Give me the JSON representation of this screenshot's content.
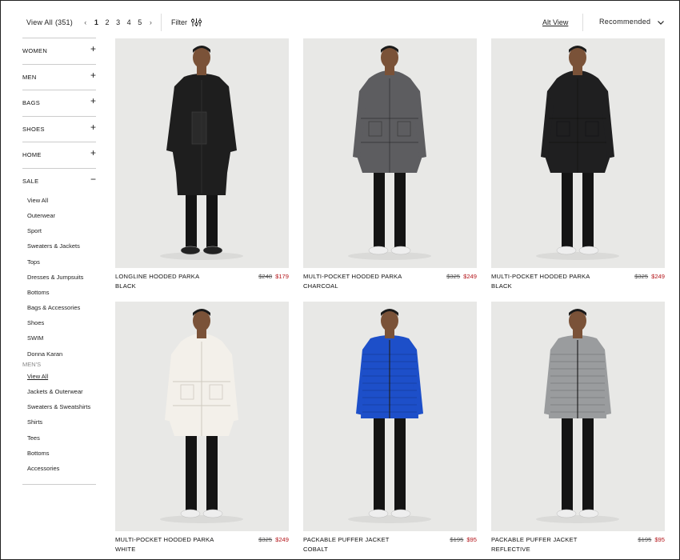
{
  "toolbar": {
    "view_all": "View All",
    "count": "(351)",
    "pages": [
      "1",
      "2",
      "3",
      "4",
      "5"
    ],
    "prev": "‹",
    "next": "›",
    "filter": "Filter",
    "alt_view": "Alt View",
    "sort": "Recommended"
  },
  "sidebar": {
    "categories": [
      {
        "label": "WOMEN",
        "toggle": "+"
      },
      {
        "label": "MEN",
        "toggle": "+"
      },
      {
        "label": "BAGS",
        "toggle": "+"
      },
      {
        "label": "SHOES",
        "toggle": "+"
      },
      {
        "label": "HOME",
        "toggle": "+"
      },
      {
        "label": "SALE",
        "toggle": "−"
      }
    ],
    "sale_items": [
      "View All",
      "Outerwear",
      "Sport",
      "Sweaters & Jackets",
      "Tops",
      "Dresses & Jumpsuits",
      "Bottoms",
      "Bags & Accessories",
      "Shoes",
      "SWIM",
      "Donna Karan"
    ],
    "mens_heading": "MEN'S",
    "mens_items": [
      "View All",
      "Jackets & Outerwear",
      "Sweaters & Sweatshirts",
      "Shirts",
      "Tees",
      "Bottoms",
      "Accessories"
    ]
  },
  "products": [
    {
      "name1": "LONGLINE HOODED PARKA",
      "name2": "BLACK",
      "old": "$248",
      "new": "$179",
      "coat": "#1e1e1e",
      "style": "long"
    },
    {
      "name1": "MULTI-POCKET HOODED PARKA",
      "name2": "CHARCOAL",
      "old": "$325",
      "new": "$249",
      "coat": "#5d5d60",
      "style": "parka"
    },
    {
      "name1": "MULTI-POCKET HOODED PARKA",
      "name2": "BLACK",
      "old": "$325",
      "new": "$249",
      "coat": "#1f1f20",
      "style": "parka"
    },
    {
      "name1": "MULTI-POCKET HOODED PARKA",
      "name2": "WHITE",
      "old": "$325",
      "new": "$249",
      "coat": "#f3f0ea",
      "style": "parka"
    },
    {
      "name1": "PACKABLE PUFFER JACKET",
      "name2": "COBALT",
      "old": "$195",
      "new": "$95",
      "coat": "#1d4fc9",
      "style": "puffer"
    },
    {
      "name1": "PACKABLE PUFFER JACKET",
      "name2": "REFLECTIVE",
      "old": "$195",
      "new": "$95",
      "coat": "#9a9c9e",
      "style": "puffer"
    }
  ]
}
